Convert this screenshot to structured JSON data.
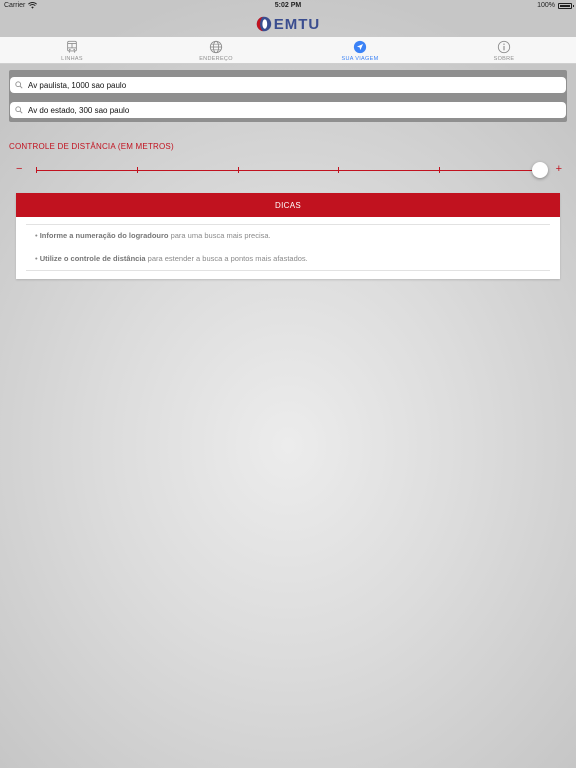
{
  "status_bar": {
    "carrier": "Carrier",
    "time": "5:02 PM",
    "battery": "100%"
  },
  "header": {
    "logo_text": "EMTU"
  },
  "tabs": [
    {
      "label": "LINHAS",
      "icon": "bus-icon",
      "active": false
    },
    {
      "label": "ENDEREÇO",
      "icon": "globe-icon",
      "active": false
    },
    {
      "label": "SUA VIAGEM",
      "icon": "navigation-arrow-icon",
      "active": true
    },
    {
      "label": "SOBRE",
      "icon": "info-icon",
      "active": false
    }
  ],
  "search": {
    "origin_value": "Av paulista, 1000 sao paulo",
    "destination_value": "Av do estado, 300 sao paulo"
  },
  "distance": {
    "label": "CONTROLE DE DISTÂNCIA (EM METROS)",
    "minus": "−",
    "plus": "+",
    "value_fraction": 1.0
  },
  "tips": {
    "title": "DICAS",
    "items": [
      {
        "bullet": "•",
        "bold": "Informe a numeração do logradouro",
        "rest": " para uma busca mais precisa."
      },
      {
        "bullet": "•",
        "bold": "Utilize o controle de distância",
        "rest": " para estender a busca a pontos mais afastados."
      }
    ]
  },
  "colors": {
    "accent_red": "#c1121f",
    "active_tab_blue": "#3b82f6",
    "logo_blue": "#3a4d8f"
  }
}
